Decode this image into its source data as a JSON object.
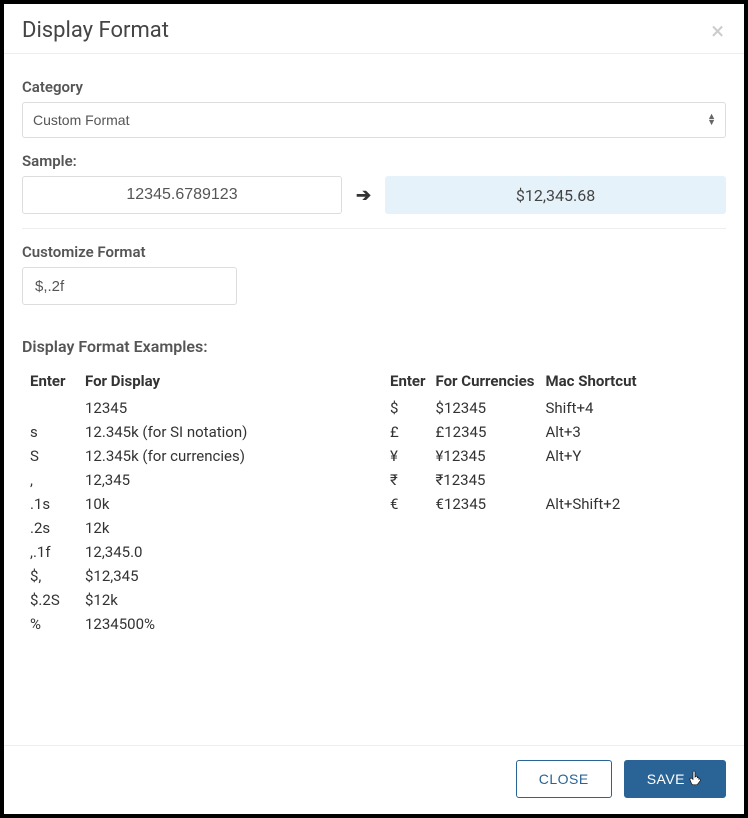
{
  "header": {
    "title": "Display Format"
  },
  "category": {
    "label": "Category",
    "value": "Custom Format"
  },
  "sample": {
    "label": "Sample:",
    "input": "12345.6789123",
    "output": "$12,345.68"
  },
  "customize": {
    "label": "Customize Format",
    "value": "$,.2f"
  },
  "examples": {
    "heading": "Display Format Examples:",
    "left": {
      "headers": [
        "Enter",
        "For Display"
      ],
      "rows": [
        {
          "enter": "",
          "display": "12345"
        },
        {
          "enter": "s",
          "display": "12.345k (for SI notation)"
        },
        {
          "enter": "S",
          "display": "12.345k (for currencies)"
        },
        {
          "enter": ",",
          "display": "12,345"
        },
        {
          "enter": ".1s",
          "display": "10k"
        },
        {
          "enter": ".2s",
          "display": "12k"
        },
        {
          "enter": ",.1f",
          "display": "12,345.0"
        },
        {
          "enter": "$,",
          "display": "$12,345"
        },
        {
          "enter": "$.2S",
          "display": "$12k"
        },
        {
          "enter": "%",
          "display": "1234500%"
        }
      ]
    },
    "right": {
      "headers": [
        "Enter",
        "For Currencies",
        "Mac Shortcut"
      ],
      "rows": [
        {
          "enter": "$",
          "display": "$12345",
          "shortcut": "Shift+4"
        },
        {
          "enter": "£",
          "display": "£12345",
          "shortcut": "Alt+3"
        },
        {
          "enter": "¥",
          "display": "¥12345",
          "shortcut": "Alt+Y"
        },
        {
          "enter": "₹",
          "display": "₹12345",
          "shortcut": ""
        },
        {
          "enter": "€",
          "display": "€12345",
          "shortcut": "Alt+Shift+2"
        }
      ]
    }
  },
  "footer": {
    "close": "CLOSE",
    "save": "SAVE"
  }
}
